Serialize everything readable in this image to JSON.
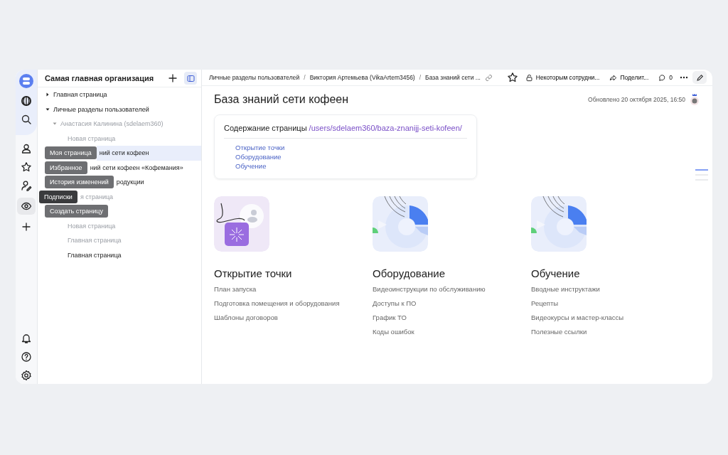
{
  "rail": {
    "items": [
      {
        "selected": false
      },
      {
        "selected": false
      },
      {
        "selected": false
      },
      {
        "selected": true
      },
      {
        "selected": false
      }
    ]
  },
  "tooltips": [
    {
      "text": "Моя страница",
      "selected": false
    },
    {
      "text": "Избранное",
      "selected": false
    },
    {
      "text": "История изменений",
      "selected": false
    },
    {
      "text": "Подписки",
      "selected": true
    },
    {
      "text": "Создать страницу",
      "selected": false
    }
  ],
  "sidebar": {
    "title": "Самая главная организация",
    "tree": [
      {
        "label": "Главная страница",
        "expanded": false,
        "dimmed": false,
        "selected": false
      },
      {
        "label": "Личные разделы пользователей",
        "expanded": true,
        "dimmed": false,
        "selected": false,
        "children": [
          {
            "label": "Анастасия Калинина (sdelaem360)",
            "expanded": true,
            "dimmed": true,
            "selected": false,
            "children": [
              {
                "label": "Новая страница",
                "dimmed": true,
                "selected": false
              },
              {
                "label": "ний сети кофеен",
                "dimmed": false,
                "selected": true
              },
              {
                "label": "ний сети кофеен «Кофемания»",
                "dimmed": false,
                "selected": false
              },
              {
                "label": "родукции",
                "dimmed": false,
                "selected": false
              },
              {
                "label": "я страница",
                "dimmed": true,
                "selected": false
              },
              {
                "label": "Новая страница",
                "dimmed": true,
                "selected": false
              },
              {
                "label": "Главная страница",
                "dimmed": true,
                "selected": false
              },
              {
                "label": "Главная страница",
                "dimmed": false,
                "selected": false
              }
            ]
          }
        ]
      }
    ]
  },
  "breadcrumbs": [
    {
      "kind": "link",
      "text": "Личные разделы пользователей"
    },
    {
      "kind": "separator",
      "text": "/"
    },
    {
      "kind": "link",
      "text": "Виктория Артемьева (VikaArtem3456)"
    },
    {
      "kind": "separator",
      "text": "/"
    },
    {
      "kind": "link",
      "text": "База знаний сети ..."
    }
  ],
  "toolbar": {
    "access": "Некоторым сотрудни...",
    "share": "Поделит...",
    "comments": "0"
  },
  "page": {
    "title": "База знаний сети кофеен",
    "updated": "Обновлено 20 октября 2025, 16:50",
    "toc": {
      "label": "Содержание страницы",
      "path": "/users/sdelaem360/baza-znanijj-seti-kofeen/",
      "links": [
        "Открытие точки",
        "Оборудование",
        "Обучение"
      ]
    },
    "sections": [
      {
        "kind": "launch",
        "title": "Открытие точки",
        "links": [
          "План запуска",
          "Подготовка помещения и оборудования",
          "Шаблоны договоров"
        ]
      },
      {
        "kind": "chart",
        "title": "Оборудование",
        "links": [
          "Видеоинструкции по обслуживанию",
          "Доступы к ПО",
          "График ТО",
          "Коды ошибок"
        ]
      },
      {
        "kind": "chart",
        "title": "Обучение",
        "links": [
          "Вводные инструктажи",
          "Рецепты",
          "Видеокурсы и мастер-классы",
          "Полезные ссылки"
        ]
      }
    ]
  }
}
